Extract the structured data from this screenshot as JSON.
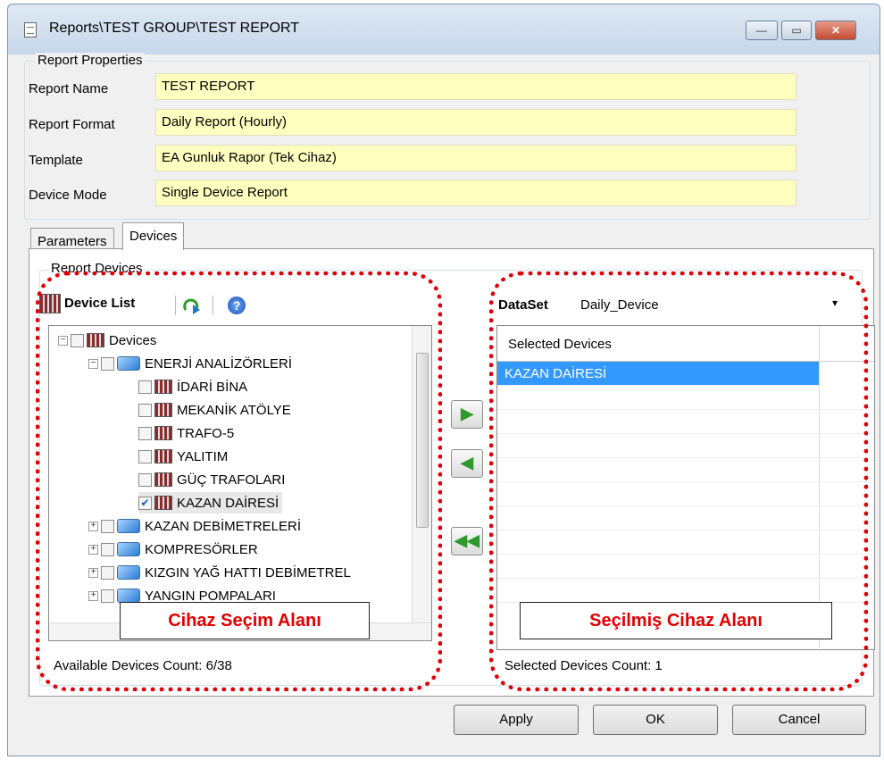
{
  "window": {
    "title": "Reports\\TEST GROUP\\TEST REPORT",
    "min": "—",
    "max": "▭",
    "close": "✕"
  },
  "report_properties": {
    "group_label": "Report Properties",
    "fields": [
      {
        "label": "Report Name",
        "value": "TEST REPORT"
      },
      {
        "label": "Report Format",
        "value": "Daily Report (Hourly)"
      },
      {
        "label": "Template",
        "value": "EA Gunluk Rapor (Tek Cihaz)"
      },
      {
        "label": "Device Mode",
        "value": "Single Device Report"
      }
    ]
  },
  "tabs": [
    {
      "label": "Parameters"
    },
    {
      "label": "Devices"
    }
  ],
  "report_devices_label": "Report Devices",
  "device_list": {
    "title": "Device List",
    "icons": [
      "device-list-icon",
      "refresh-icon",
      "help-icon"
    ],
    "tree": [
      {
        "label": "Devices",
        "expander": "−",
        "checked": false
      },
      {
        "label": "ENERJİ ANALİZÖRLERİ",
        "expander": "−",
        "checked": false
      },
      {
        "label": "İDARİ BİNA",
        "checked": false
      },
      {
        "label": "MEKANİK ATÖLYE",
        "checked": false
      },
      {
        "label": "TRAFO-5",
        "checked": false
      },
      {
        "label": "YALITIM",
        "checked": false
      },
      {
        "label": "GÜÇ TRAFOLARI",
        "checked": false
      },
      {
        "label": "KAZAN DAİRESİ",
        "checked": true
      },
      {
        "label": "KAZAN DEBİMETRELERİ",
        "expander": "+",
        "checked": false
      },
      {
        "label": "KOMPRESÖRLER",
        "expander": "+",
        "checked": false
      },
      {
        "label": "KIZGIN YAĞ HATTI DEBİMETREL",
        "expander": "+",
        "checked": false
      },
      {
        "label": "YANGIN POMPALARI",
        "expander": "+",
        "checked": false
      }
    ],
    "available_count": "Available Devices Count: 6/38"
  },
  "arrows": {
    "add": "▶",
    "remove": "◀",
    "remove_all": "◀◀"
  },
  "dataset": {
    "label": "DataSet",
    "value": "Daily_Device",
    "arrow": "▾"
  },
  "selected": {
    "header": "Selected Devices",
    "rows": [
      "KAZAN DAİRESİ"
    ],
    "count": "Selected Devices Count: 1"
  },
  "annotations": {
    "left": "Cihaz Seçim Alanı",
    "right": "Seçilmiş Cihaz Alanı",
    "color": "#e0000a"
  },
  "buttons": {
    "apply": "Apply",
    "ok": "OK",
    "cancel": "Cancel"
  }
}
